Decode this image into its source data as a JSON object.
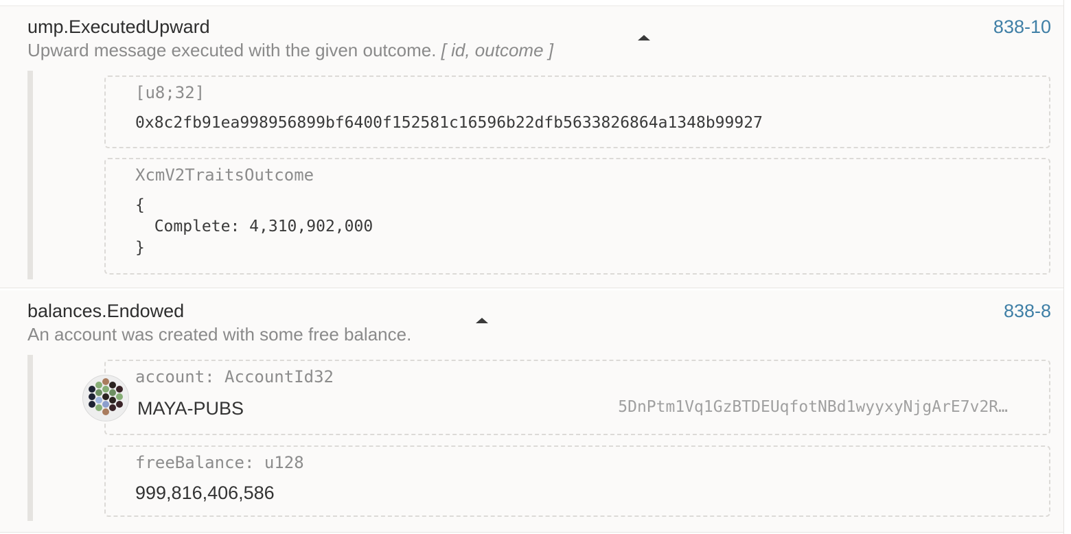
{
  "events": [
    {
      "name": "ump.ExecutedUpward",
      "description": "Upward message executed with the given outcome.",
      "params_hint": "[ id, outcome ]",
      "link": "838-10",
      "params": [
        {
          "label": "[u8;32]",
          "value": "0x8c2fb91ea998956899bf6400f152581c16596b22dfb5633826864a1348b99927"
        },
        {
          "label": "XcmV2TraitsOutcome",
          "value": "{\n  Complete: 4,310,902,000\n}"
        }
      ]
    },
    {
      "name": "balances.Endowed",
      "description": "An account was created with some free balance.",
      "link": "838-8",
      "params": [
        {
          "label": "account: AccountId32",
          "name": "MAYA-PUBS",
          "address": "5DnPtm1Vq1GzBTDEUqfotNBd1wyyxyNjgArE7v2R…"
        },
        {
          "label": "freeBalance: u128",
          "value": "999,816,406,586"
        }
      ]
    }
  ],
  "icons": {
    "collapse": "caret-up-icon",
    "identicon": "identicon"
  },
  "colors": {
    "link": "#3f7fa6",
    "background": "#fbfaf9",
    "border": "#dcdad7"
  }
}
